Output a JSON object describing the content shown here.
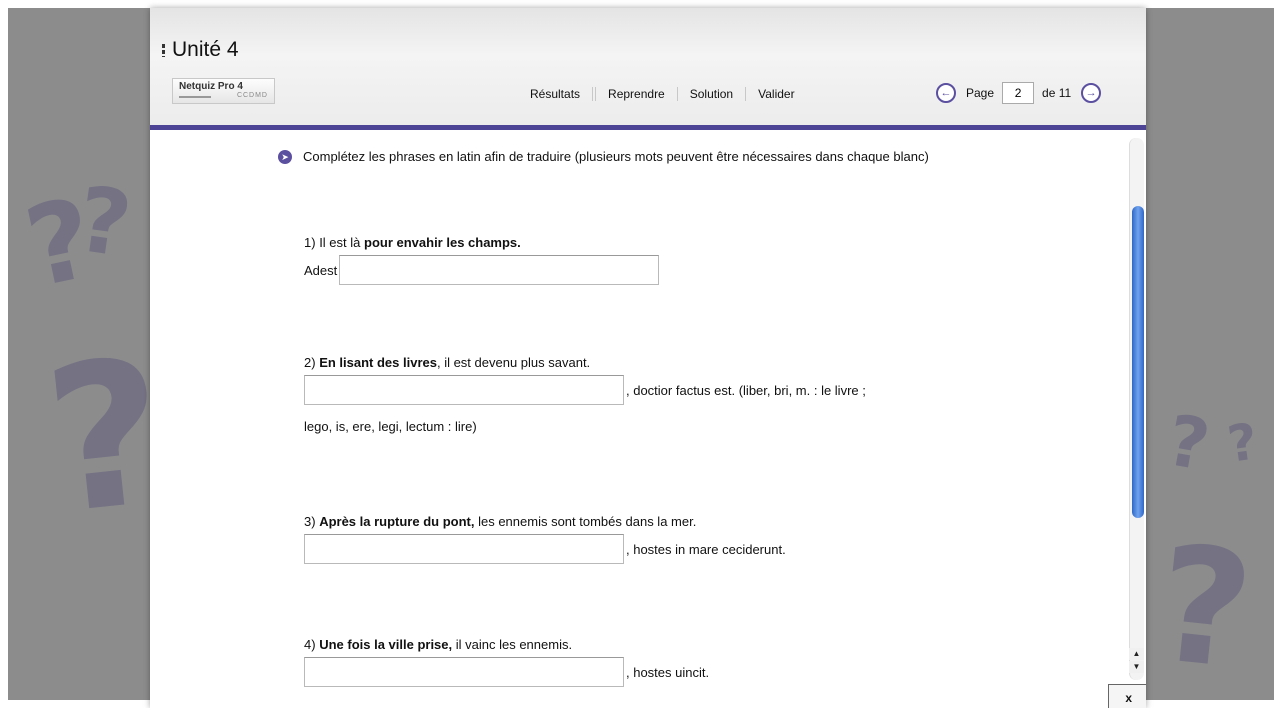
{
  "header": {
    "unit_title": "Unité 4",
    "logo_line1": "Netquiz Pro 4",
    "logo_line2": "CCDMD"
  },
  "toolbar": {
    "results_label": "Résultats",
    "resume_label": "Reprendre",
    "solution_label": "Solution",
    "validate_label": "Valider"
  },
  "pager": {
    "prev_icon": "chevron-left-circle",
    "next_icon": "chevron-right-circle",
    "page_label": "Page",
    "current_page": "2",
    "of_label": "de 11"
  },
  "instructions": "Complétez les phrases en latin afin de traduire (plusieurs mots peuvent être nécessaires dans chaque blanc)",
  "questions": [
    {
      "num": "1)",
      "pre": "Il est là",
      "bold": "pour envahir les champs.",
      "post": "",
      "prefix": "Adest",
      "answer": "",
      "suffix": "",
      "extra": ""
    },
    {
      "num": "2)",
      "pre": "",
      "bold": "En lisant des livres",
      "post": ", il est devenu plus savant.",
      "prefix": "",
      "answer": "",
      "suffix": ", doctior factus est. (liber, bri, m. : le livre ;",
      "extra": "lego, is, ere, legi, lectum : lire)"
    },
    {
      "num": "3)",
      "pre": "",
      "bold": "Après la rupture du pont,",
      "post": " les ennemis sont tombés dans la mer.",
      "prefix": "",
      "answer": "",
      "suffix": ", hostes in mare ceciderunt.",
      "extra": ""
    },
    {
      "num": "4)",
      "pre": "",
      "bold": "Une fois la ville prise,",
      "post": " il vainc les ennemis.",
      "prefix": "",
      "answer": "",
      "suffix": ", hostes uincit.",
      "extra": ""
    }
  ],
  "close_label": "x",
  "colors": {
    "accent": "#4e4496",
    "scroll_thumb": "#3b74d6",
    "background": "#8c8c8c"
  }
}
